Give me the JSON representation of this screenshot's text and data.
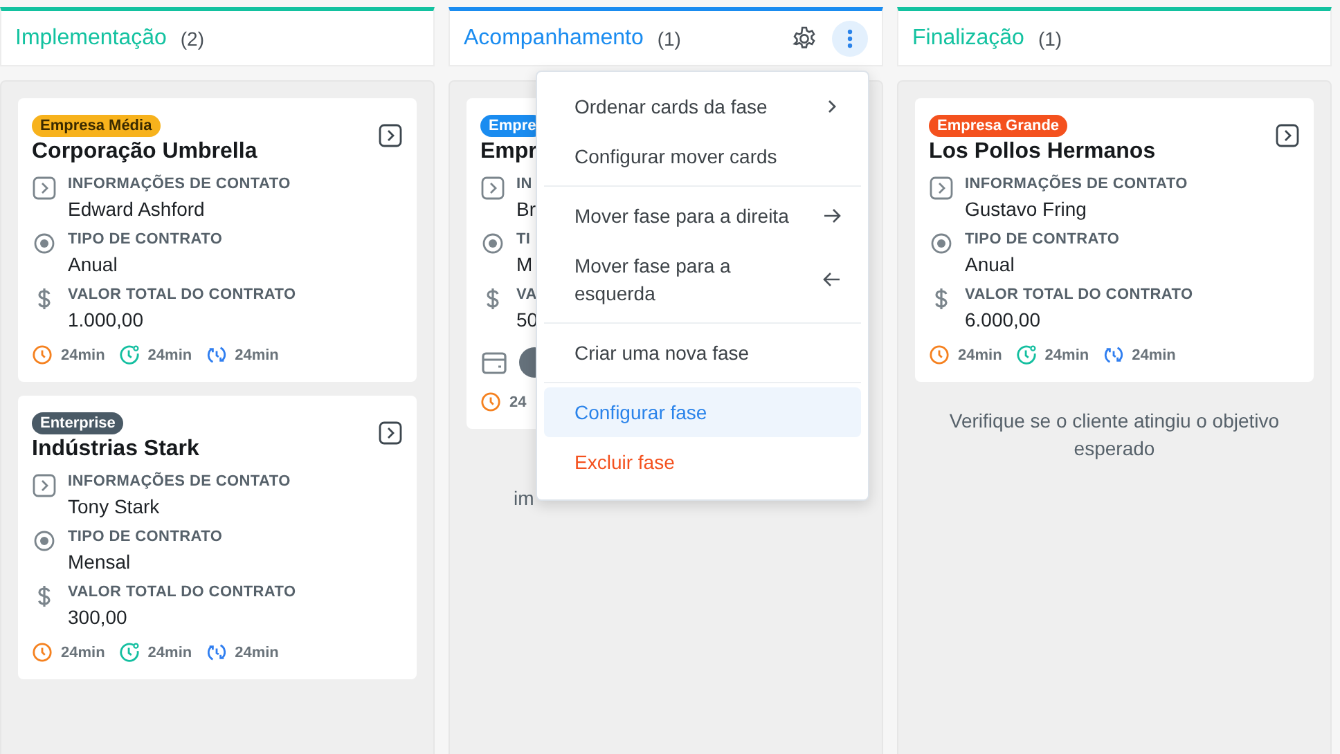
{
  "columns": [
    {
      "title": "Implementação",
      "count": "(2)",
      "color": "#13c2a0",
      "menu_open": false,
      "cards": [
        {
          "badge": {
            "text": "Empresa Média",
            "color": "#f7b21c",
            "dark_text": true
          },
          "title": "Corporação Umbrella",
          "fields": [
            {
              "kind": "contact",
              "label": "INFORMAÇÕES DE CONTATO",
              "value": "Edward Ashford"
            },
            {
              "kind": "contract",
              "label": "TIPO DE CONTRATO",
              "value": "Anual"
            },
            {
              "kind": "money",
              "label": "VALOR TOTAL DO CONTRATO",
              "value": "1.000,00"
            }
          ],
          "timers": [
            {
              "kind": "clock",
              "text": "24min"
            },
            {
              "kind": "alarm",
              "text": "24min"
            },
            {
              "kind": "sync",
              "text": "24min"
            }
          ]
        },
        {
          "badge": {
            "text": "Enterprise",
            "color": "#4a5a66",
            "dark_text": false
          },
          "title": "Indústrias Stark",
          "fields": [
            {
              "kind": "contact",
              "label": "INFORMAÇÕES DE CONTATO",
              "value": "Tony Stark"
            },
            {
              "kind": "contract",
              "label": "TIPO DE CONTRATO",
              "value": "Mensal"
            },
            {
              "kind": "money",
              "label": "VALOR TOTAL DO CONTRATO",
              "value": "300,00"
            }
          ],
          "timers": [
            {
              "kind": "clock",
              "text": "24min"
            },
            {
              "kind": "alarm",
              "text": "24min"
            },
            {
              "kind": "sync",
              "text": "24min"
            }
          ]
        }
      ]
    },
    {
      "title": "Acompanhamento",
      "count": "(1)",
      "color": "#1a8cf0",
      "menu_open": true,
      "cards": [
        {
          "badge": {
            "text": "Empre",
            "color": "#1a8cf0",
            "dark_text": false
          },
          "title": "Empr",
          "fields": [
            {
              "kind": "contact",
              "label": "IN",
              "value": "Br"
            },
            {
              "kind": "contract",
              "label": "TI",
              "value": "M"
            },
            {
              "kind": "money",
              "label": "VA",
              "value": "50"
            }
          ],
          "attachments": [
            {
              "kind": "calendar"
            },
            {
              "kind": "avatar"
            }
          ],
          "timers": [
            {
              "kind": "clock",
              "text": "24"
            }
          ]
        }
      ],
      "note": "im"
    },
    {
      "title": "Finalização",
      "count": "(1)",
      "color": "#13c2a0",
      "menu_open": false,
      "cards": [
        {
          "badge": {
            "text": "Empresa Grande",
            "color": "#f4511e",
            "dark_text": false
          },
          "title": "Los Pollos Hermanos",
          "fields": [
            {
              "kind": "contact",
              "label": "INFORMAÇÕES DE CONTATO",
              "value": "Gustavo Fring"
            },
            {
              "kind": "contract",
              "label": "TIPO DE CONTRATO",
              "value": "Anual"
            },
            {
              "kind": "money",
              "label": "VALOR TOTAL DO CONTRATO",
              "value": "6.000,00"
            }
          ],
          "timers": [
            {
              "kind": "clock",
              "text": "24min"
            },
            {
              "kind": "alarm",
              "text": "24min"
            },
            {
              "kind": "sync",
              "text": "24min"
            }
          ]
        }
      ],
      "note": "Verifique se o cliente atingiu o objetivo esperado"
    }
  ],
  "menu": {
    "groups": [
      [
        {
          "label": "Ordenar cards da fase",
          "kind": "submenu",
          "selected": false,
          "danger": false
        },
        {
          "label": "Configurar mover cards",
          "kind": "plain",
          "selected": false,
          "danger": false
        }
      ],
      [
        {
          "label": "Mover fase para a direita",
          "kind": "right",
          "selected": false,
          "danger": false
        },
        {
          "label": "Mover fase para a esquerda",
          "kind": "left",
          "selected": false,
          "danger": false
        }
      ],
      [
        {
          "label": "Criar uma nova fase",
          "kind": "plain",
          "selected": false,
          "danger": false
        }
      ],
      [
        {
          "label": "Configurar fase",
          "kind": "plain",
          "selected": true,
          "danger": false
        },
        {
          "label": "Excluir fase",
          "kind": "plain",
          "selected": false,
          "danger": true
        }
      ]
    ]
  }
}
